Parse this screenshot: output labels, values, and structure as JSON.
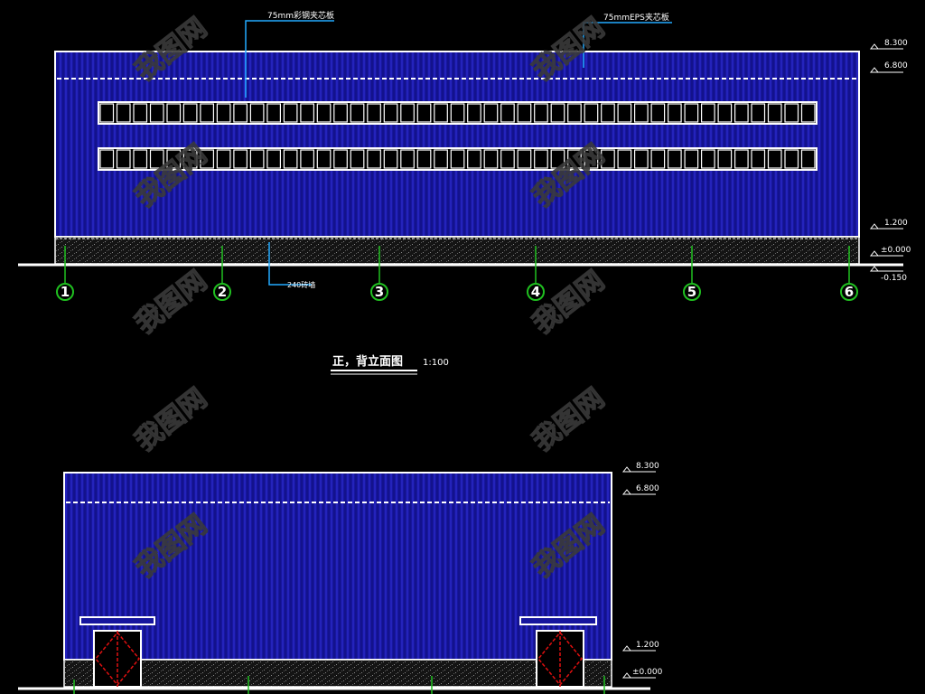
{
  "drawing": {
    "background": "#000000",
    "wall_color": "#17169e",
    "rib_color": "#2b2ad0",
    "outline_color": "#ffffff",
    "axis_line_color": "#20c020",
    "door_symbol_color": "#e01010"
  },
  "front_elevation": {
    "annotations": {
      "left_callout": "75mm彩钢夹芯板",
      "right_callout": "75mmEPS夹芯板",
      "plinth_callout": "240砖墙"
    },
    "elevations": [
      "8.300",
      "6.800",
      "1.200",
      "±0.000",
      "-0.150"
    ],
    "axis_labels": [
      "1",
      "2",
      "3",
      "4",
      "5",
      "6"
    ],
    "title": "正，背立面图",
    "scale": "1:100",
    "window_row_count": 2,
    "panes_per_row": 43
  },
  "side_elevation": {
    "elevations": [
      "8.300",
      "6.800",
      "1.200",
      "±0.000"
    ],
    "door_count": 2
  },
  "watermark": {
    "text": "我图网"
  }
}
